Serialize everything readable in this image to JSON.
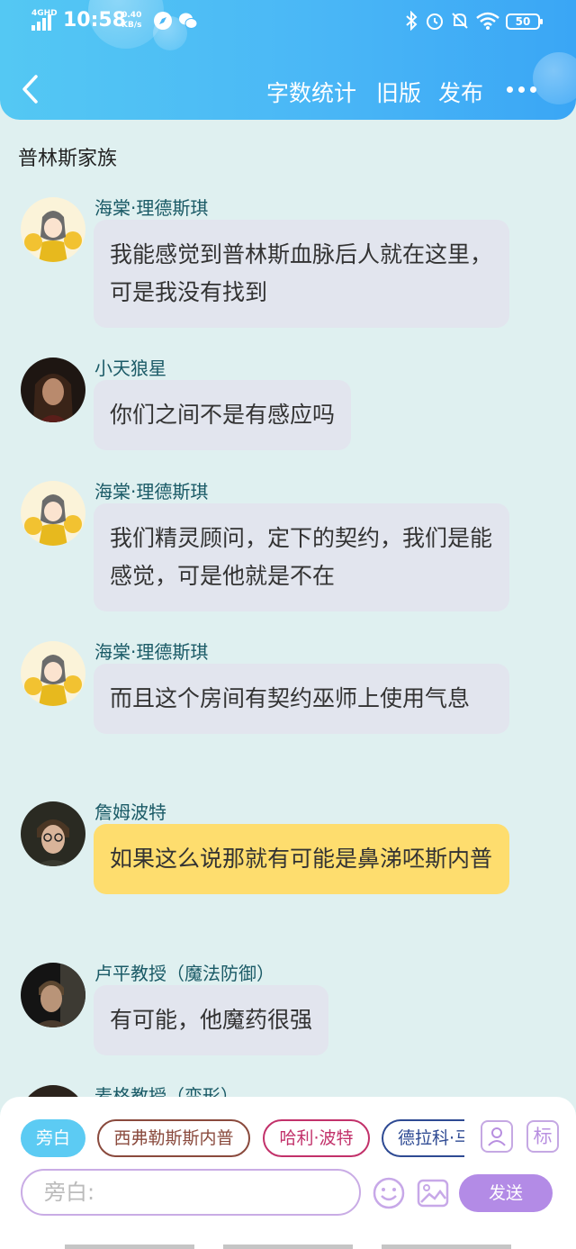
{
  "status_bar": {
    "network": "4GHD",
    "time": "10:58",
    "speed_value": "0.40",
    "speed_unit": "KB/s",
    "battery": "50"
  },
  "header": {
    "back_icon": "chevron-left-icon",
    "actions": [
      "字数统计",
      "旧版",
      "发布"
    ],
    "more_icon": "more-dots-icon"
  },
  "chat": {
    "title": "普林斯家族",
    "messages": [
      {
        "name": "海棠·理德斯琪",
        "text": "我能感觉到普林斯血脉后人就在这里，可是我没有找到",
        "avatar": "anime-girl",
        "style": "gray"
      },
      {
        "name": "小天狼星",
        "text": "你们之间不是有感应吗",
        "avatar": "man-long-hair",
        "style": "gray"
      },
      {
        "name": "海棠·理德斯琪",
        "text": "我们精灵顾问，定下的契约，我们是能感觉，可是他就是不在",
        "avatar": "anime-girl",
        "style": "gray"
      },
      {
        "name": "海棠·理德斯琪",
        "text": "而且这个房间有契约巫师上使用气息",
        "avatar": "anime-girl",
        "style": "gray"
      },
      {
        "name": "詹姆波特",
        "text": "如果这么说那就有可能是鼻涕呸斯内普",
        "avatar": "young-man-glasses",
        "style": "yellow"
      },
      {
        "name": "卢平教授（魔法防御）",
        "text": "有可能，他魔药很强",
        "avatar": "man-portrait",
        "style": "gray"
      },
      {
        "name": "麦格教授（变形）",
        "text": "",
        "avatar": "woman-portrait",
        "style": "gray"
      }
    ]
  },
  "composer": {
    "roles": [
      "旁白",
      "西弗勒斯斯内普",
      "哈利·波特",
      "德拉科·马尔福"
    ],
    "tool_user_icon": "user-card-icon",
    "tool_label": "标",
    "placeholder": "旁白:",
    "emoji_icon": "smile-icon",
    "image_icon": "image-icon",
    "send_label": "发送"
  },
  "colors": {
    "header_gradient_start": "#54c8f3",
    "header_gradient_end": "#3aa6f5",
    "page_bg": "#dff0f0",
    "bubble_gray": "#e2e5ee",
    "bubble_yellow": "#fedd6e",
    "name_color": "#1a5a66",
    "send_button": "#b38be6"
  }
}
